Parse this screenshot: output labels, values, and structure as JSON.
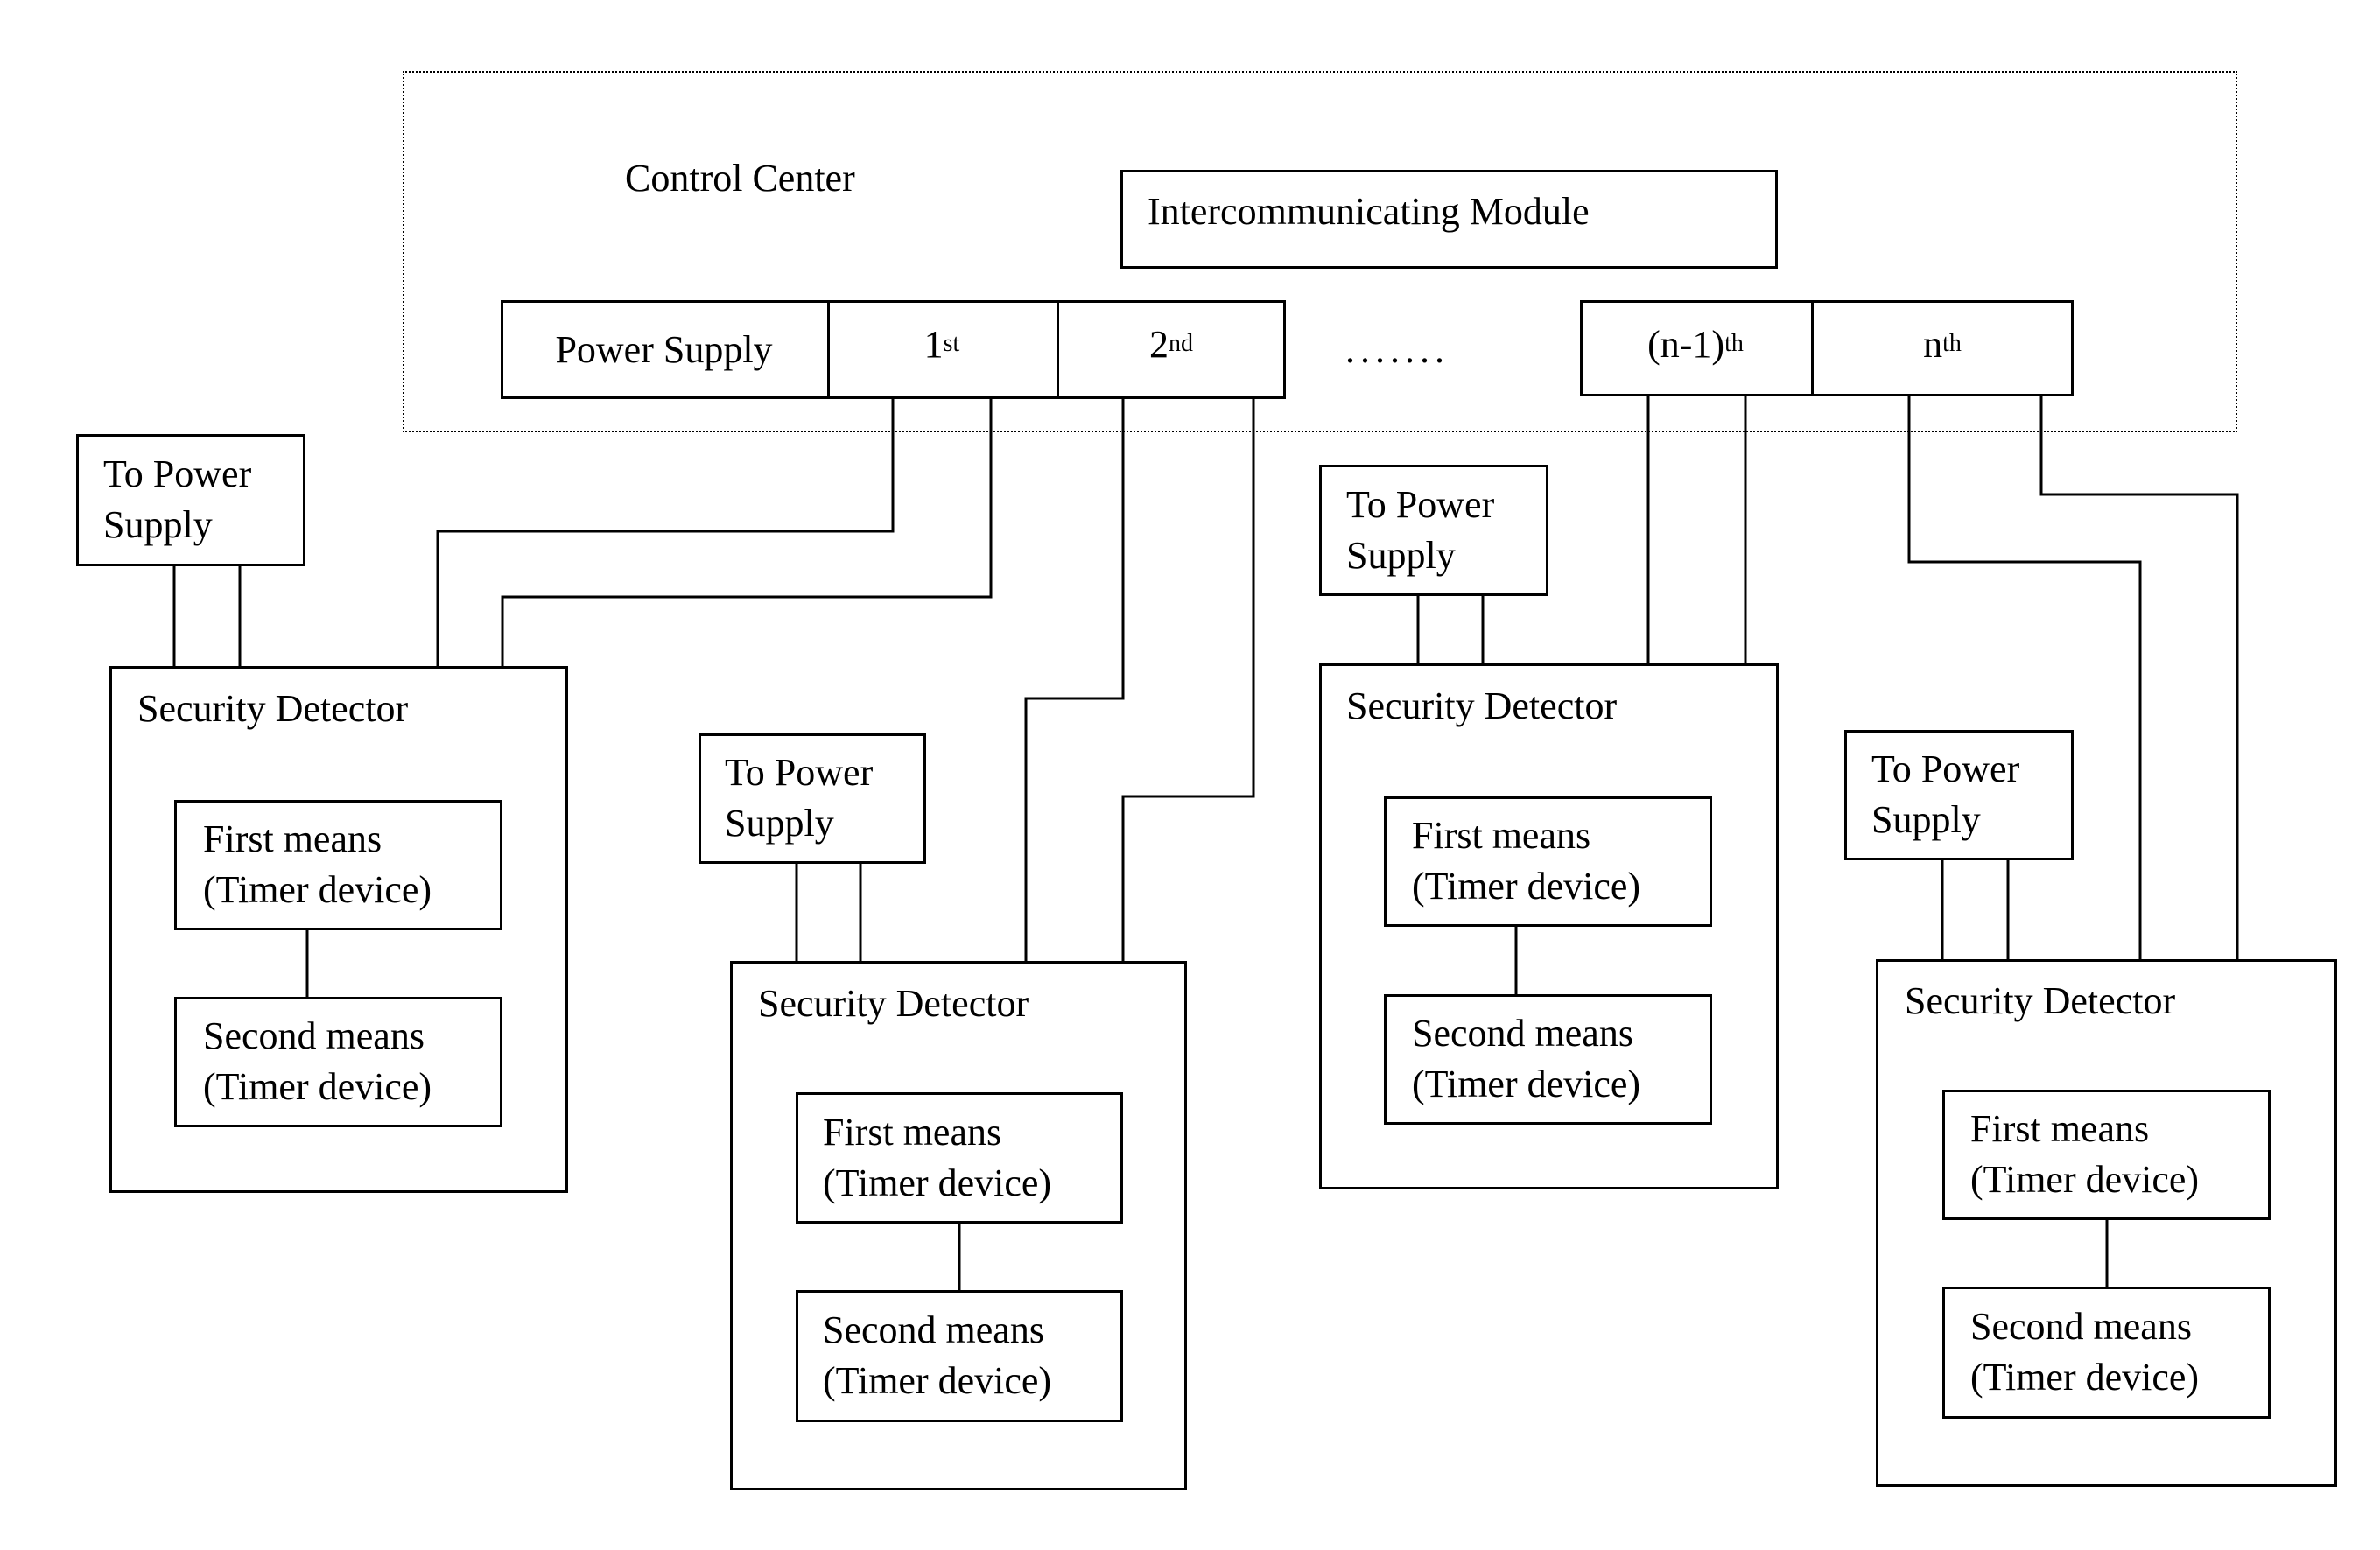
{
  "control_center": {
    "title": "Control Center",
    "intercommunicating_module": "Intercommunicating Module",
    "power_supply": "Power Supply",
    "channels": [
      {
        "base": "1",
        "sup": "st"
      },
      {
        "base": "2",
        "sup": "nd"
      },
      {
        "base": "(n-1)",
        "sup": "th"
      },
      {
        "base": "n",
        "sup": "th"
      }
    ],
    "ellipsis": "......."
  },
  "detectors": [
    {
      "to_power_line1": "To Power",
      "to_power_line2": "Supply",
      "title": "Security Detector",
      "first_line1": "First means",
      "first_line2": "(Timer device)",
      "second_line1": "Second means",
      "second_line2": "(Timer device)"
    },
    {
      "to_power_line1": "To Power",
      "to_power_line2": "Supply",
      "title": "Security Detector",
      "first_line1": "First means",
      "first_line2": "(Timer device)",
      "second_line1": "Second means",
      "second_line2": "(Timer device)"
    },
    {
      "to_power_line1": "To Power",
      "to_power_line2": "Supply",
      "title": "Security Detector",
      "first_line1": "First means",
      "first_line2": "(Timer device)",
      "second_line1": "Second means",
      "second_line2": "(Timer device)"
    },
    {
      "to_power_line1": "To Power",
      "to_power_line2": "Supply",
      "title": "Security Detector",
      "first_line1": "First means",
      "first_line2": "(Timer device)",
      "second_line1": "Second means",
      "second_line2": "(Timer device)"
    }
  ]
}
